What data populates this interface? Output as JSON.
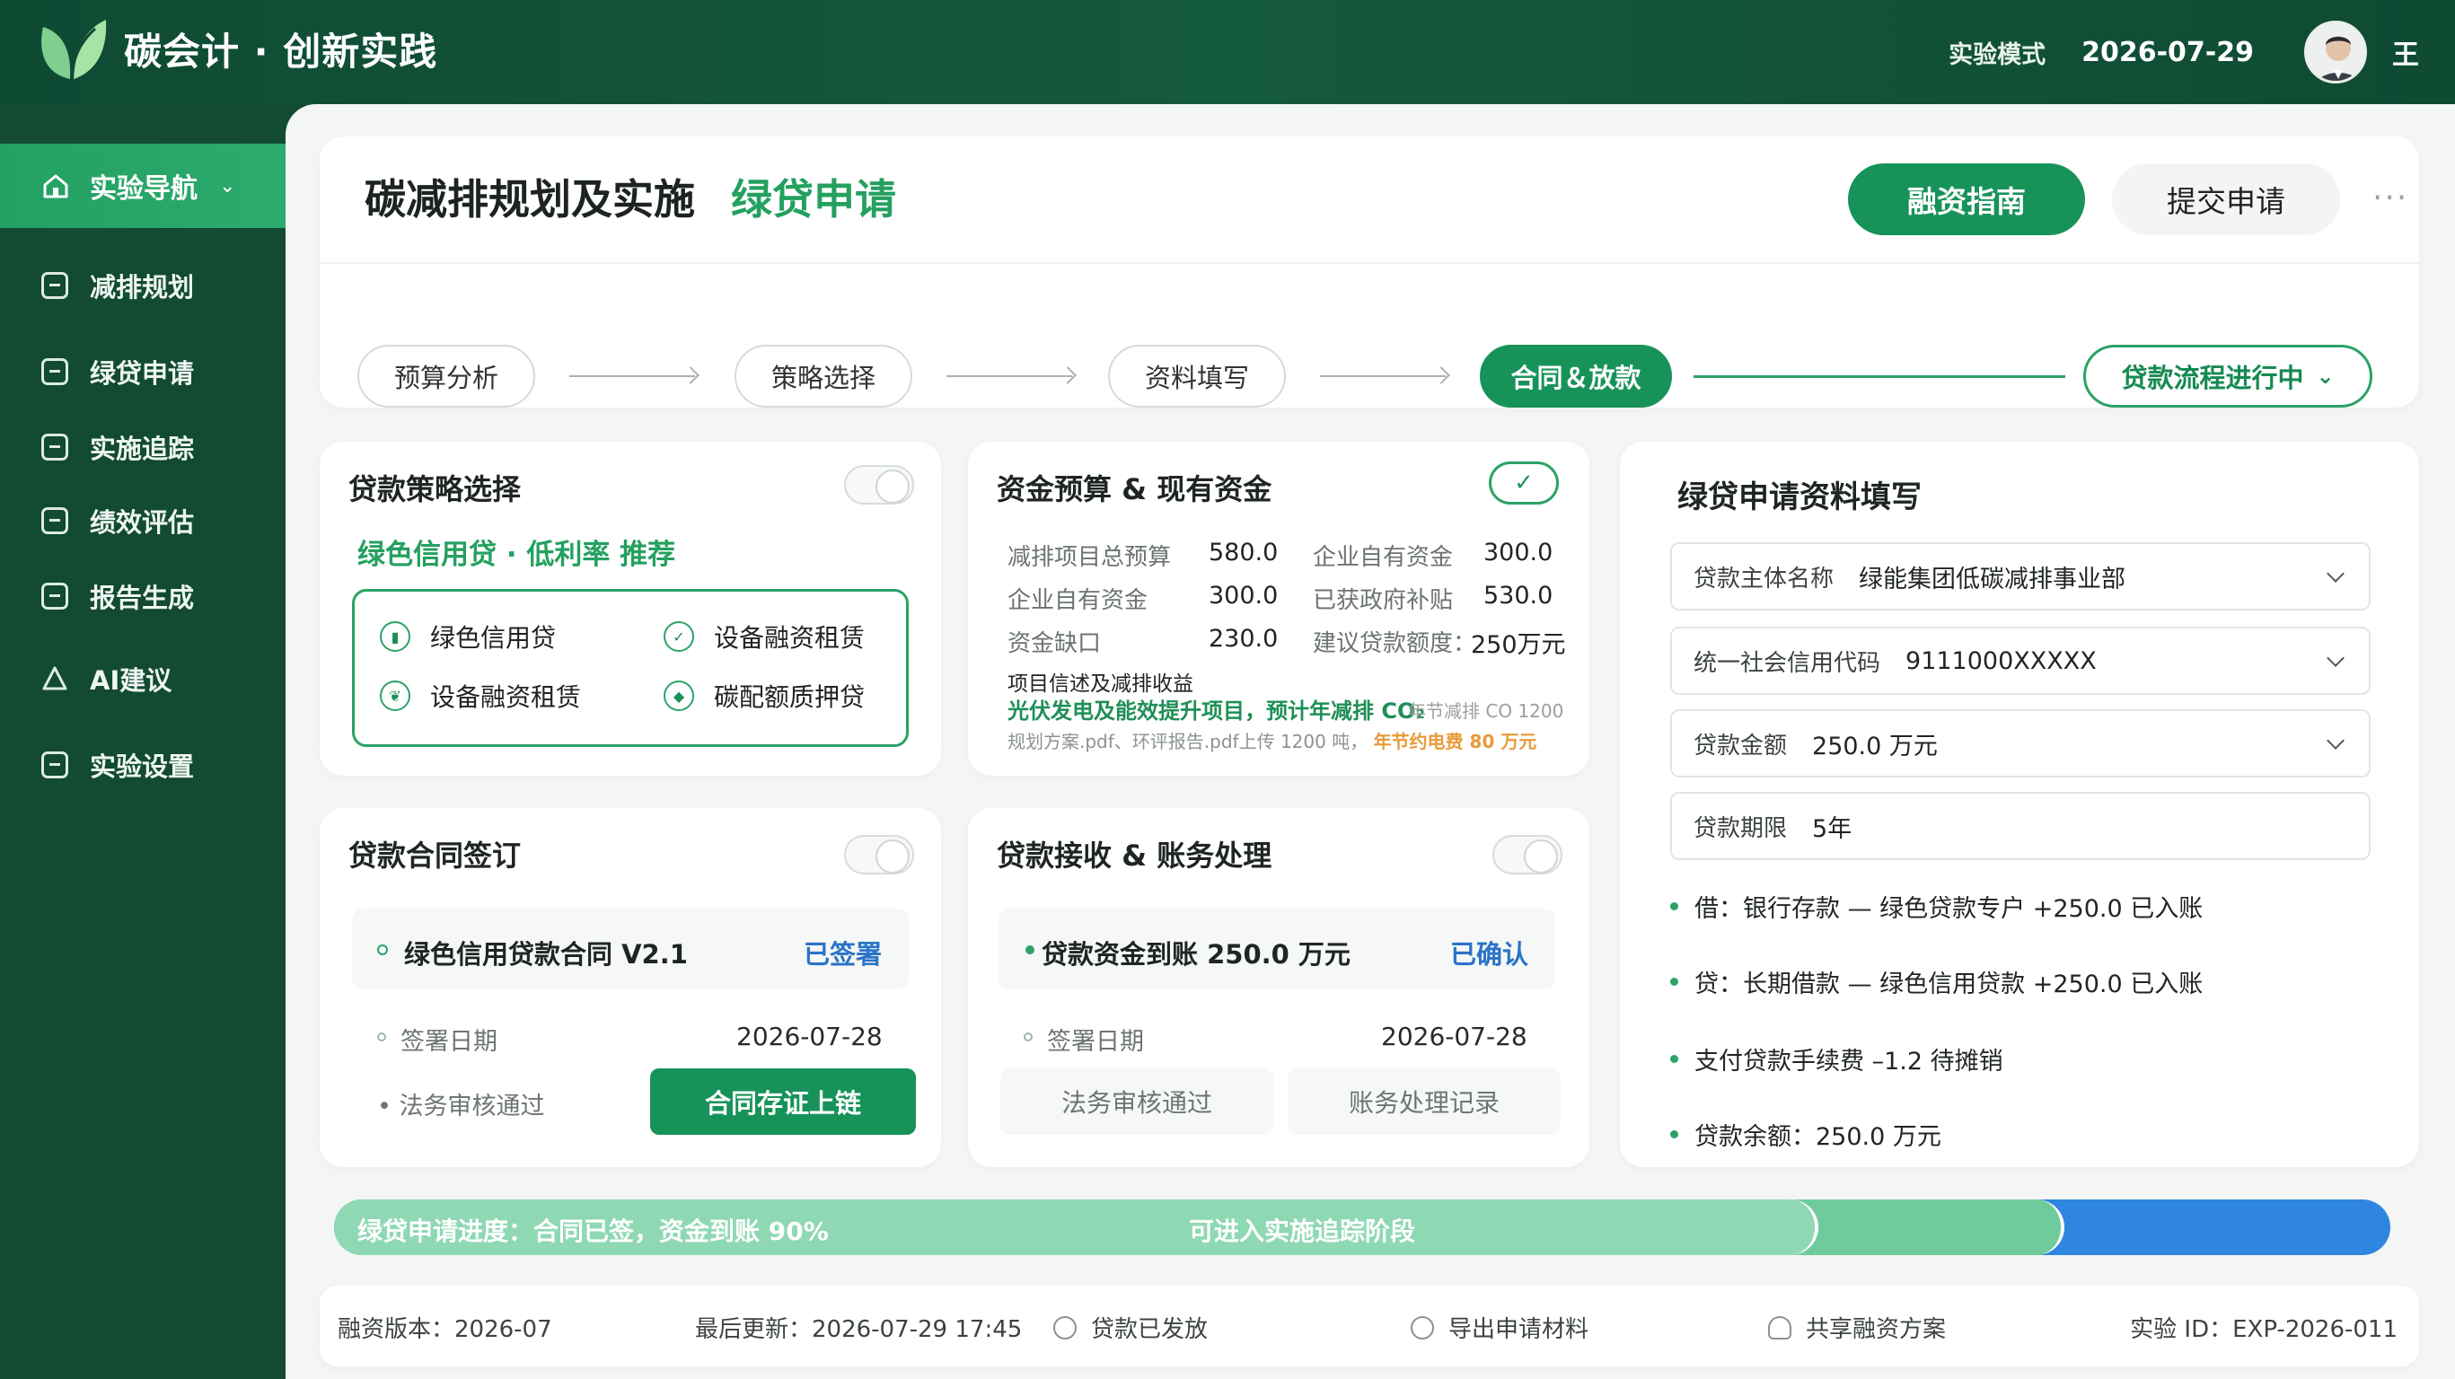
{
  "app": {
    "title": "碳会计 · 创新实践",
    "mode": "实验模式",
    "date": "2026-07-29",
    "user_name": "王"
  },
  "sidebar": {
    "head_label": "实验导航",
    "items": [
      {
        "label": "减排规划"
      },
      {
        "label": "绿贷申请"
      },
      {
        "label": "实施追踪"
      },
      {
        "label": "绩效评估"
      },
      {
        "label": "报告生成"
      },
      {
        "label": "AI建议"
      },
      {
        "label": "实验设置"
      }
    ]
  },
  "header": {
    "title": "碳减排规划及实施",
    "subtitle": "绿贷申请",
    "guide_button": "融资指南",
    "submit_button": "提交申请",
    "more": "···"
  },
  "steps": {
    "items": [
      {
        "label": "预算分析"
      },
      {
        "label": "策略选择"
      },
      {
        "label": "资料填写"
      },
      {
        "label": "合同＆放款"
      }
    ],
    "status": "贷款流程进行中"
  },
  "strategy": {
    "title": "贷款策略选择",
    "recommend": "绿色信用贷 · 低利率 推荐",
    "options": [
      {
        "label": "绿色信用贷"
      },
      {
        "label": "设备融资租赁"
      },
      {
        "label": "设备融资租赁"
      },
      {
        "label": "碳配额质押贷"
      }
    ]
  },
  "budget": {
    "title": "资金预算 & 现有资金",
    "check": "✓",
    "rows": [
      {
        "l1": "减排项目总预算",
        "v1": "580.0",
        "l2": "企业自有资金",
        "v2": "300.0"
      },
      {
        "l1": "企业自有资金",
        "v1": "300.0",
        "l2": "已获政府补贴",
        "v2": "530.0"
      },
      {
        "l1": "资金缺口",
        "v1": "230.0",
        "l2": "建议贷款额度：",
        "v2": "250万元"
      }
    ],
    "project_title": "项目信述及减排收益",
    "project_line": "光伏发电及能效提升项目，预计年减排 CO₂",
    "project_extra": "年节减排 CO 1200",
    "project_file": "规划方案.pdf、环评报告.pdf上传",
    "project_amount": "1200 吨，",
    "project_saving": "年节约电费 80 万元"
  },
  "contract": {
    "title": "贷款合同签订",
    "name": "绿色信用贷款合同 V2.1",
    "status": "已签署",
    "date_label": "签署日期",
    "date_value": "2026-07-28",
    "review": "法务审核通过",
    "store_button": "合同存证上链"
  },
  "receive": {
    "title": "贷款接收 & 账务处理",
    "name": "贷款资金到账 250.0 万元",
    "status": "已确认",
    "date_label": "签署日期",
    "date_value": "2026-07-28",
    "review": "法务审核通过",
    "record": "账务处理记录"
  },
  "form": {
    "title": "绿贷申请资料填写",
    "fields": [
      {
        "label": "贷款主体名称",
        "value": "绿能集团低碳减排事业部"
      },
      {
        "label": "统一社会信用代码",
        "value": "9111000XXXXX"
      },
      {
        "label": "贷款金额",
        "value": "250.0 万元"
      },
      {
        "label": "贷款期限",
        "value": "5年"
      }
    ],
    "entries": [
      {
        "text": "借：银行存款 — 绿色贷款专户 +250.0 已入账"
      },
      {
        "text": "贷：长期借款 — 绿色信用贷款 +250.0 已入账"
      },
      {
        "text": "支付贷款手续费 –1.2 待摊销"
      },
      {
        "text": "贷款余额：250.0 万元"
      }
    ]
  },
  "progress": {
    "text": "绿贷申请进度：合同已签，资金到账 90%",
    "next": "可进入实施追踪阶段",
    "percent": 90
  },
  "footer": {
    "version": "融资版本：2026-07",
    "updated": "最后更新：2026-07-29 17:45",
    "released": "贷款已发放",
    "export": "导出申请材料",
    "share": "共享融资方案",
    "exp_id": "实验 ID：EXP-2026-011"
  }
}
